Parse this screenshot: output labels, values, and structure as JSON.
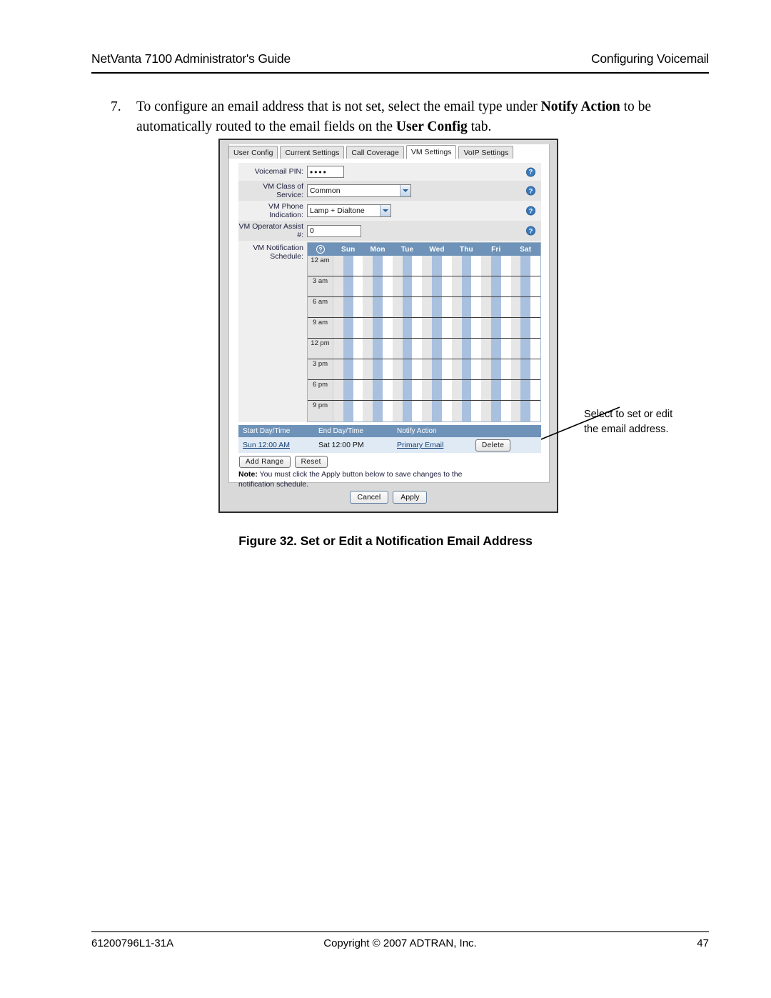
{
  "header": {
    "left": "NetVanta 7100 Administrator's Guide",
    "right": "Configuring Voicemail"
  },
  "step": {
    "number": "7.",
    "part1": "To configure an email address that is not set, select the email type under ",
    "bold1": "Notify Action",
    "part2": " to be automatically routed to the email fields on the ",
    "bold2": "User Config",
    "part3": " tab."
  },
  "screenshot": {
    "tabs": [
      {
        "label": "User Config",
        "active": false
      },
      {
        "label": "Current Settings",
        "active": false
      },
      {
        "label": "Call Coverage",
        "active": false
      },
      {
        "label": "VM Settings",
        "active": true
      },
      {
        "label": "VoIP Settings",
        "active": false
      }
    ],
    "fields": {
      "pin_label": "Voicemail PIN:",
      "pin_value": "••••",
      "cos_label": "VM Class of Service:",
      "cos_value": "Common",
      "cos_options": [
        "Common"
      ],
      "indication_label": "VM Phone Indication:",
      "indication_value": "Lamp + Dialtone",
      "indication_options": [
        "Lamp + Dialtone"
      ],
      "operator_label": "VM Operator Assist #:",
      "operator_value": "0",
      "help_icon": "help-question-icon"
    },
    "schedule": {
      "label": "VM Notification Schedule:",
      "corner_icon": "help-question-icon",
      "days": [
        "Sun",
        "Mon",
        "Tue",
        "Wed",
        "Thu",
        "Fri",
        "Sat"
      ],
      "times": [
        "12 am",
        "3 am",
        "6 am",
        "9 am",
        "12 pm",
        "3 pm",
        "6 pm",
        "9 pm"
      ]
    },
    "table": {
      "headers": [
        "Start Day/Time",
        "End Day/Time",
        "Notify Action"
      ],
      "rows": [
        {
          "start": "Sun 12:00 AM",
          "end": "Sat 12:00 PM",
          "action": "Primary Email",
          "delete_label": "Delete"
        }
      ],
      "add_range_label": "Add Range",
      "reset_label": "Reset",
      "note_prefix": "Note:",
      "note_text": " You must click the Apply button below to save changes to the notification schedule."
    },
    "footer_buttons": {
      "cancel_label": "Cancel",
      "apply_label": "Apply"
    }
  },
  "callout": {
    "line1": "Select to set or edit",
    "line2": "the email address."
  },
  "caption": "Figure 32.  Set or Edit a Notification Email Address",
  "footer": {
    "left": "61200796L1-31A",
    "center": "Copyright © 2007 ADTRAN, Inc.",
    "right": "47"
  }
}
